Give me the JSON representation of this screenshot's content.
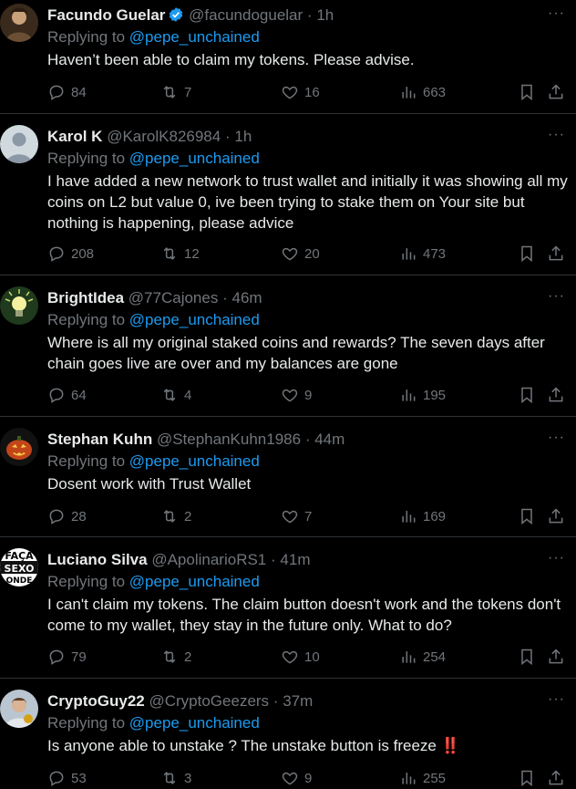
{
  "tweets": [
    {
      "name": "Facundo Guelar",
      "verified": true,
      "handle": "@facundoguelar",
      "time": "1h",
      "replying_label": "Replying to",
      "replying_to": "@pepe_unchained",
      "text": "Haven’t been able to claim my tokens. Please advise.",
      "replies": "84",
      "retweets": "7",
      "likes": "16",
      "views": "663"
    },
    {
      "name": "Karol K",
      "verified": false,
      "handle": "@KarolK826984",
      "time": "1h",
      "replying_label": "Replying to",
      "replying_to": "@pepe_unchained",
      "text": "I have added a new network to trust wallet and initially it was showing all my coins on L2 but value 0, ive been trying to stake them on Your site but nothing is happening, please advice",
      "replies": "208",
      "retweets": "12",
      "likes": "20",
      "views": "473"
    },
    {
      "name": "BrightIdea",
      "verified": false,
      "handle": "@77Cajones",
      "time": "46m",
      "replying_label": "Replying to",
      "replying_to": "@pepe_unchained",
      "text": "Where is all my original staked coins and rewards? The seven days after chain goes live are over and my balances are gone",
      "replies": "64",
      "retweets": "4",
      "likes": "9",
      "views": "195"
    },
    {
      "name": "Stephan Kuhn",
      "verified": false,
      "handle": "@StephanKuhn1986",
      "time": "44m",
      "replying_label": "Replying to",
      "replying_to": "@pepe_unchained",
      "text": "Dosent work with Trust Wallet",
      "replies": "28",
      "retweets": "2",
      "likes": "7",
      "views": "169"
    },
    {
      "name": "Luciano Silva",
      "verified": false,
      "handle": "@ApolinarioRS1",
      "time": "41m",
      "replying_label": "Replying to",
      "replying_to": "@pepe_unchained",
      "text": "I can't claim my tokens. The claim button doesn't work and the tokens don't come to my wallet, they stay in the future only. What to do?",
      "replies": "79",
      "retweets": "2",
      "likes": "10",
      "views": "254",
      "avatar_text": [
        "FAÇA",
        "SEXO",
        "ONDE"
      ]
    },
    {
      "name": "CryptoGuy22",
      "verified": false,
      "handle": "@CryptoGeezers",
      "time": "37m",
      "replying_label": "Replying to",
      "replying_to": "@pepe_unchained",
      "text": "Is anyone  able to unstake ? The unstake button is freeze ‼️",
      "replies": "53",
      "retweets": "3",
      "likes": "9",
      "views": "255"
    }
  ],
  "separator": "·",
  "more_glyph": "···",
  "colors": {
    "background": "#000000",
    "text": "#e7e9ea",
    "muted": "#71767b",
    "link": "#1d9bf0",
    "divider": "#2f3336"
  },
  "icons": [
    "verified-badge-icon",
    "reply-icon",
    "retweet-icon",
    "like-icon",
    "views-icon",
    "bookmark-icon",
    "share-icon",
    "more-icon"
  ]
}
